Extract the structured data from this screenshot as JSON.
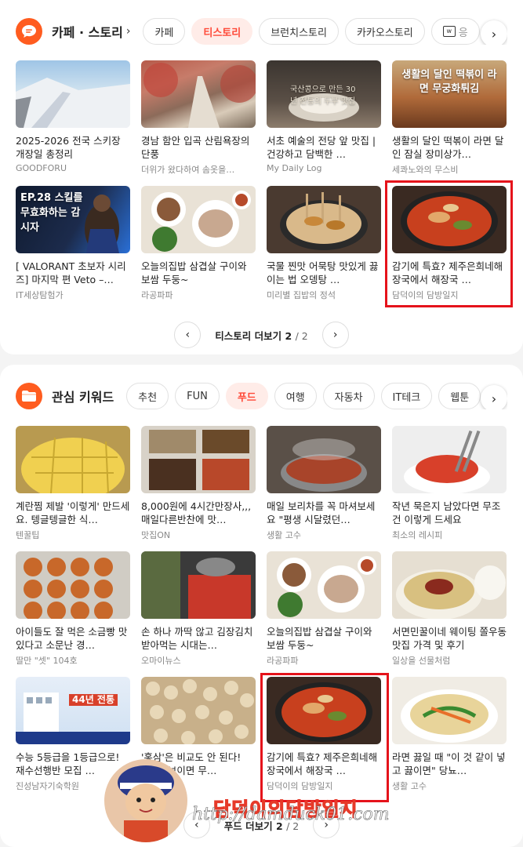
{
  "story": {
    "title": "카페 · 스토리",
    "chips": [
      {
        "label": "카페",
        "active": false
      },
      {
        "label": "티스토리",
        "active": true
      },
      {
        "label": "브런치스토리",
        "active": false
      },
      {
        "label": "카카오스토리",
        "active": false
      },
      {
        "label": "응",
        "active": false
      }
    ],
    "items": [
      {
        "title": "2025-2026 전국 스키장 개장일 총정리",
        "source": "GOODFORU"
      },
      {
        "title": "경남 함안 입곡 산림욕장의 단풍",
        "source": "더위가 왔다하여 솜옷을…"
      },
      {
        "title": "서초 예술의 전당 앞 맛집 | 건강하고 담백한 …",
        "source": "My Daily Log",
        "overlay": "국산콩으로 만든 30년 전통의 두부 맛집"
      },
      {
        "title": "생활의 달인 떡볶이 라면 달인 잠실 장미상가…",
        "source": "세콰노와의 무스비",
        "overlay": "생활의 달인 떡볶이 라면 무궁화튀김"
      },
      {
        "title": "[ VALORANT 초보자 시리즈] 마지막 편 Veto –…",
        "source": "IT세상탐험가",
        "overlay": "EP.28 스킬를 무효화하는 감시자"
      },
      {
        "title": "오늘의집밥 삼겹살 구이와 보쌈 두둥~",
        "source": "라공파파"
      },
      {
        "title": "국물 찐맛 어묵탕 맛있게 끓이는 법 오뎅탕 …",
        "source": "미리별 집밥의 정석"
      },
      {
        "title": "감기에 특효? 제주은희네해장국에서 해장국 …",
        "source": "담덕이의 담방일지"
      }
    ],
    "pager": {
      "label": "티스토리 더보기",
      "page": "2",
      "total": "/ 2"
    }
  },
  "keywords": {
    "title": "관심 키워드",
    "chips": [
      {
        "label": "추천",
        "active": false
      },
      {
        "label": "FUN",
        "active": false
      },
      {
        "label": "푸드",
        "active": true
      },
      {
        "label": "여행",
        "active": false
      },
      {
        "label": "자동차",
        "active": false
      },
      {
        "label": "IT테크",
        "active": false
      },
      {
        "label": "웹툰",
        "active": false
      }
    ],
    "items": [
      {
        "title": "계란찜 제발 '이렇게' 만드세요. 텡글텡글한 식…",
        "source": "텐꿀팁"
      },
      {
        "title": "8,000원에 4시간만장사,,,매일다른반찬에 맛…",
        "source": "맛집ON"
      },
      {
        "title": "매일 보리차를 꼭 마셔보세요 \"평생 시달렸던…",
        "source": "생활 고수"
      },
      {
        "title": "작년 묵은지 남았다면 무조건 이렇게 드세요",
        "source": "최소의 레시피"
      },
      {
        "title": "아이들도 잘 먹은 소금빵 맛있다고 소문난 경…",
        "source": "딸만 \"셋\" 104호"
      },
      {
        "title": "손 하나 까딱 않고 김장김치 받아먹는 시대는…",
        "source": "오마이뉴스"
      },
      {
        "title": "오늘의집밥 삼겹살 구이와 보쌈 두둥~",
        "source": "라공파파"
      },
      {
        "title": "서면민꿀이네 웨이팅 쫄우동 맛집 가격 및 후기",
        "source": "일상을 선물처럼"
      },
      {
        "title": "수능 5등급을 1등급으로! 재수선행반 모집 …",
        "source": "진성남자기숙학원",
        "overlay": "44년 전통"
      },
      {
        "title": "'홍삼'은 비교도 안 된다! '이것' 보이면 무…",
        "source": "건강연구소"
      },
      {
        "title": "감기에 특효? 제주은희네해장국에서 해장국 …",
        "source": "담덕이의 담방일지"
      },
      {
        "title": "라면 끓일 때 \"이 것 같이 넣고 끓이면\" 당뇨…",
        "source": "생활 고수"
      }
    ],
    "pager": {
      "label": "푸드 더보기",
      "page": "2",
      "total": "/ 2"
    }
  },
  "watermark": {
    "name": "담덕이의담방일지",
    "url": "http://damduck01.com"
  },
  "colors": {
    "accent": "#ff5c1f",
    "highlight": "#e5131b",
    "active_chip_text": "#ff4a39"
  }
}
